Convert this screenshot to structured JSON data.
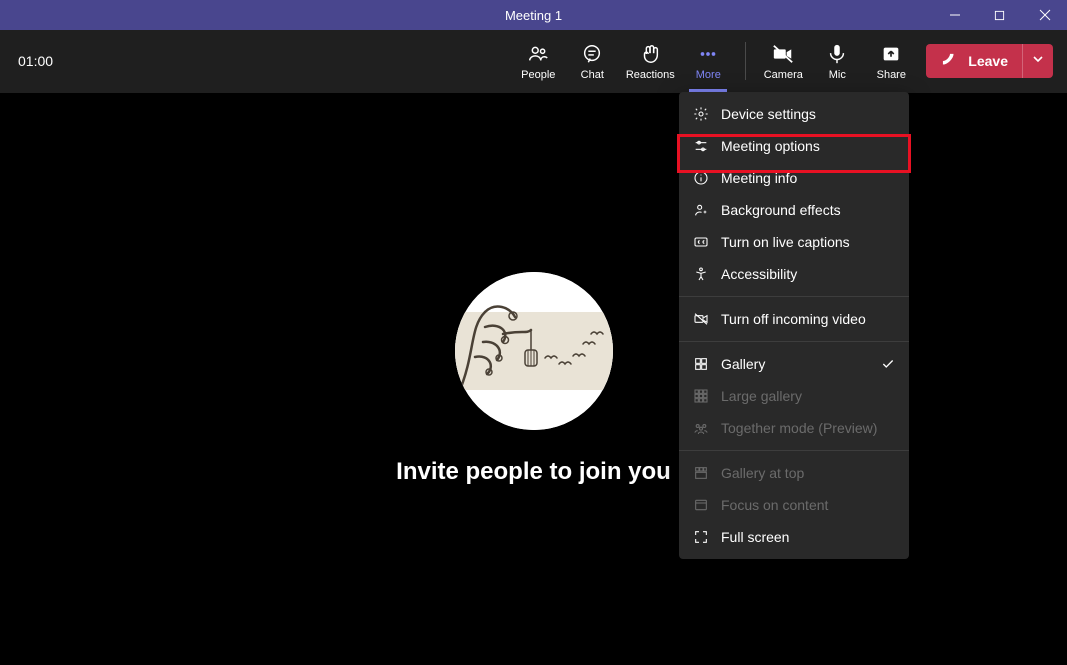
{
  "window": {
    "title": "Meeting 1"
  },
  "toolbar": {
    "timer": "01:00",
    "people": "People",
    "chat": "Chat",
    "reactions": "Reactions",
    "more": "More",
    "camera": "Camera",
    "mic": "Mic",
    "share": "Share",
    "leave": "Leave"
  },
  "stage": {
    "invite_text": "Invite people to join you"
  },
  "more_menu": [
    {
      "label": "Device settings",
      "icon": "gear-icon",
      "enabled": true,
      "checked": false
    },
    {
      "label": "Meeting options",
      "icon": "sliders-icon",
      "enabled": true,
      "checked": false,
      "highlighted": true
    },
    {
      "label": "Meeting info",
      "icon": "info-icon",
      "enabled": true,
      "checked": false
    },
    {
      "label": "Background effects",
      "icon": "person-sparkle-icon",
      "enabled": true,
      "checked": false
    },
    {
      "label": "Turn on live captions",
      "icon": "cc-icon",
      "enabled": true,
      "checked": false
    },
    {
      "label": "Accessibility",
      "icon": "accessibility-icon",
      "enabled": true,
      "checked": false
    },
    {
      "label": "Turn off incoming video",
      "icon": "video-off-icon",
      "enabled": true,
      "checked": false
    },
    {
      "label": "Gallery",
      "icon": "grid-icon",
      "enabled": true,
      "checked": true
    },
    {
      "label": "Large gallery",
      "icon": "large-grid-icon",
      "enabled": false,
      "checked": false
    },
    {
      "label": "Together mode (Preview)",
      "icon": "together-icon",
      "enabled": false,
      "checked": false
    },
    {
      "label": "Gallery at top",
      "icon": "gallery-top-icon",
      "enabled": false,
      "checked": false
    },
    {
      "label": "Focus on content",
      "icon": "focus-content-icon",
      "enabled": false,
      "checked": false
    },
    {
      "label": "Full screen",
      "icon": "fullscreen-icon",
      "enabled": true,
      "checked": false
    }
  ],
  "colors": {
    "titlebar": "#49468e",
    "accent": "#7f85f5",
    "leave": "#c4314b",
    "menu_bg": "#292929",
    "stage_bg": "#000000",
    "highlight": "#e81123"
  }
}
